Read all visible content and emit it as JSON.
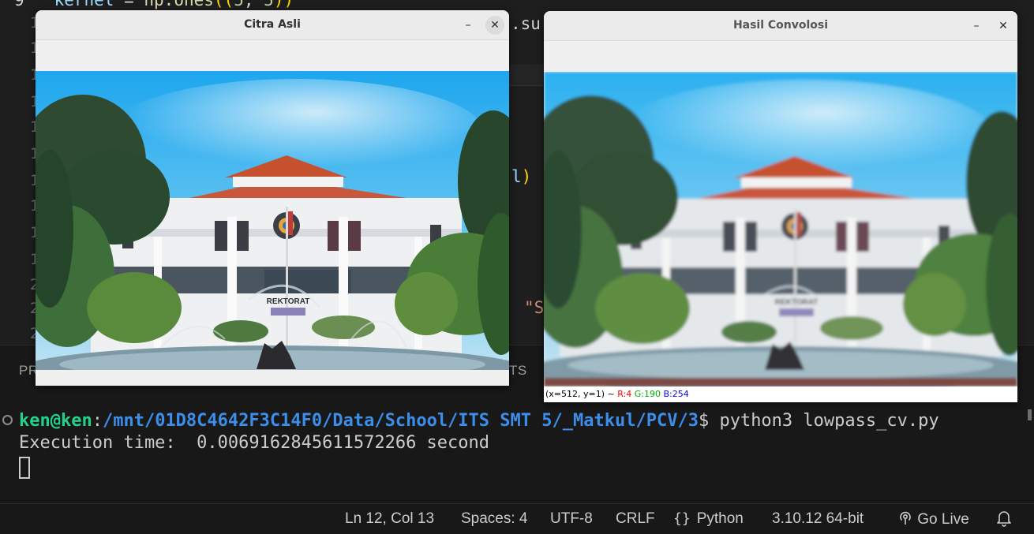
{
  "editor": {
    "gutter": [
      "9",
      "1",
      "1",
      "1",
      "1",
      "1",
      "1",
      "1",
      "1",
      "1",
      "1",
      "1",
      "2",
      "2",
      "2"
    ],
    "line_top": {
      "var": "kernel",
      "op": " = ",
      "fn": "np.ones",
      "p1": "((",
      "n1": "5",
      "sep": ", ",
      "n2": "5",
      "p2": "))"
    },
    "line_su": ".su",
    "line_l": "l)",
    "line_s": "\"S"
  },
  "panel": {
    "tabs": [
      "PR",
      "TS"
    ]
  },
  "terminal": {
    "prompt_user": "ken@ken",
    "prompt_colon": ":",
    "prompt_path": "/mnt/01D8C4642F3C14F0/Data/School/ITS SMT 5/_Matkul/PCV/3",
    "prompt_dollar": "$ ",
    "command": "python3 lowpass_cv.py",
    "output": "Execution time:  0.0069162845611572266 second"
  },
  "status_bar": {
    "position": "Ln 12, Col 13",
    "spaces": "Spaces: 4",
    "encoding": "UTF-8",
    "eol": "CRLF",
    "language_icon": "braces-icon",
    "language": "Python",
    "interpreter": "3.10.12 64-bit",
    "golive_icon": "broadcast-icon",
    "golive": "Go Live",
    "bell_icon": "bell-icon"
  },
  "windows": {
    "original": {
      "title": "Citra Asli",
      "minimize": "–",
      "close": "✕",
      "image_label": "REKTORAT"
    },
    "result": {
      "title": "Hasil Convolosi",
      "minimize": "–",
      "close": "✕",
      "image_label": "REKTORAT",
      "pixel_coord": "(x=512, y=1) ~ ",
      "pixel_r": "R:4",
      "pixel_g": "G:190",
      "pixel_b": "B:254"
    }
  },
  "colors": {
    "editor_bg": "#1e1e1e",
    "terminal_bg": "#181818",
    "prompt_user": "#23d18b",
    "prompt_path": "#3b8eea",
    "window_chrome": "#ebebeb",
    "sky": "#2fb2f0",
    "roof": "#c5512f"
  }
}
